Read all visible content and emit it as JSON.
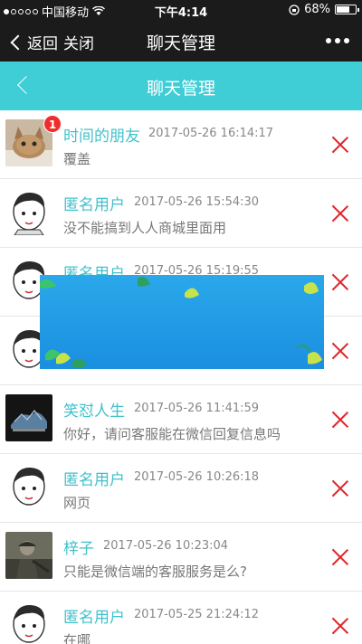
{
  "status_bar": {
    "carrier": "中国移动",
    "time": "下午4:14",
    "battery": "68%",
    "battery_level": 0.68
  },
  "wechat_nav": {
    "back_label": "返回",
    "close_label": "关闭",
    "title": "聊天管理"
  },
  "page": {
    "title": "聊天管理"
  },
  "chats": [
    {
      "name": "时间的朋友",
      "time": "2017-05-26 16:14:17",
      "message": "覆盖",
      "badge": "1",
      "avatar": "cat"
    },
    {
      "name": "匿名用户",
      "time": "2017-05-26 15:54:30",
      "message": "没不能搞到人人商城里面用",
      "avatar": "cartoon-boy"
    },
    {
      "name": "匿名用户",
      "time": "2017-05-26 15:19:55",
      "message": "",
      "avatar": "cartoon-boy"
    },
    {
      "name": "",
      "time": "",
      "message": "",
      "avatar": "cartoon-boy"
    },
    {
      "name": "笑怼人生",
      "time": "2017-05-26 11:41:59",
      "message": "你好，请问客服能在微信回复信息吗",
      "avatar": "dark-scene"
    },
    {
      "name": "匿名用户",
      "time": "2017-05-26 10:26:18",
      "message": "网页",
      "avatar": "cartoon-boy"
    },
    {
      "name": "梓子",
      "time": "2017-05-26 10:23:04",
      "message": "只能是微信端的客服服务是么?",
      "avatar": "old-photo"
    },
    {
      "name": "匿名用户",
      "time": "2017-05-25 21:24:12",
      "message": "在哪",
      "avatar": "cartoon-boy"
    }
  ],
  "colors": {
    "header": "#3fcdd6",
    "name": "#3fc1cc",
    "delete": "#e0262c",
    "badge": "#f02d2d",
    "banner": "#2aa8ea"
  }
}
